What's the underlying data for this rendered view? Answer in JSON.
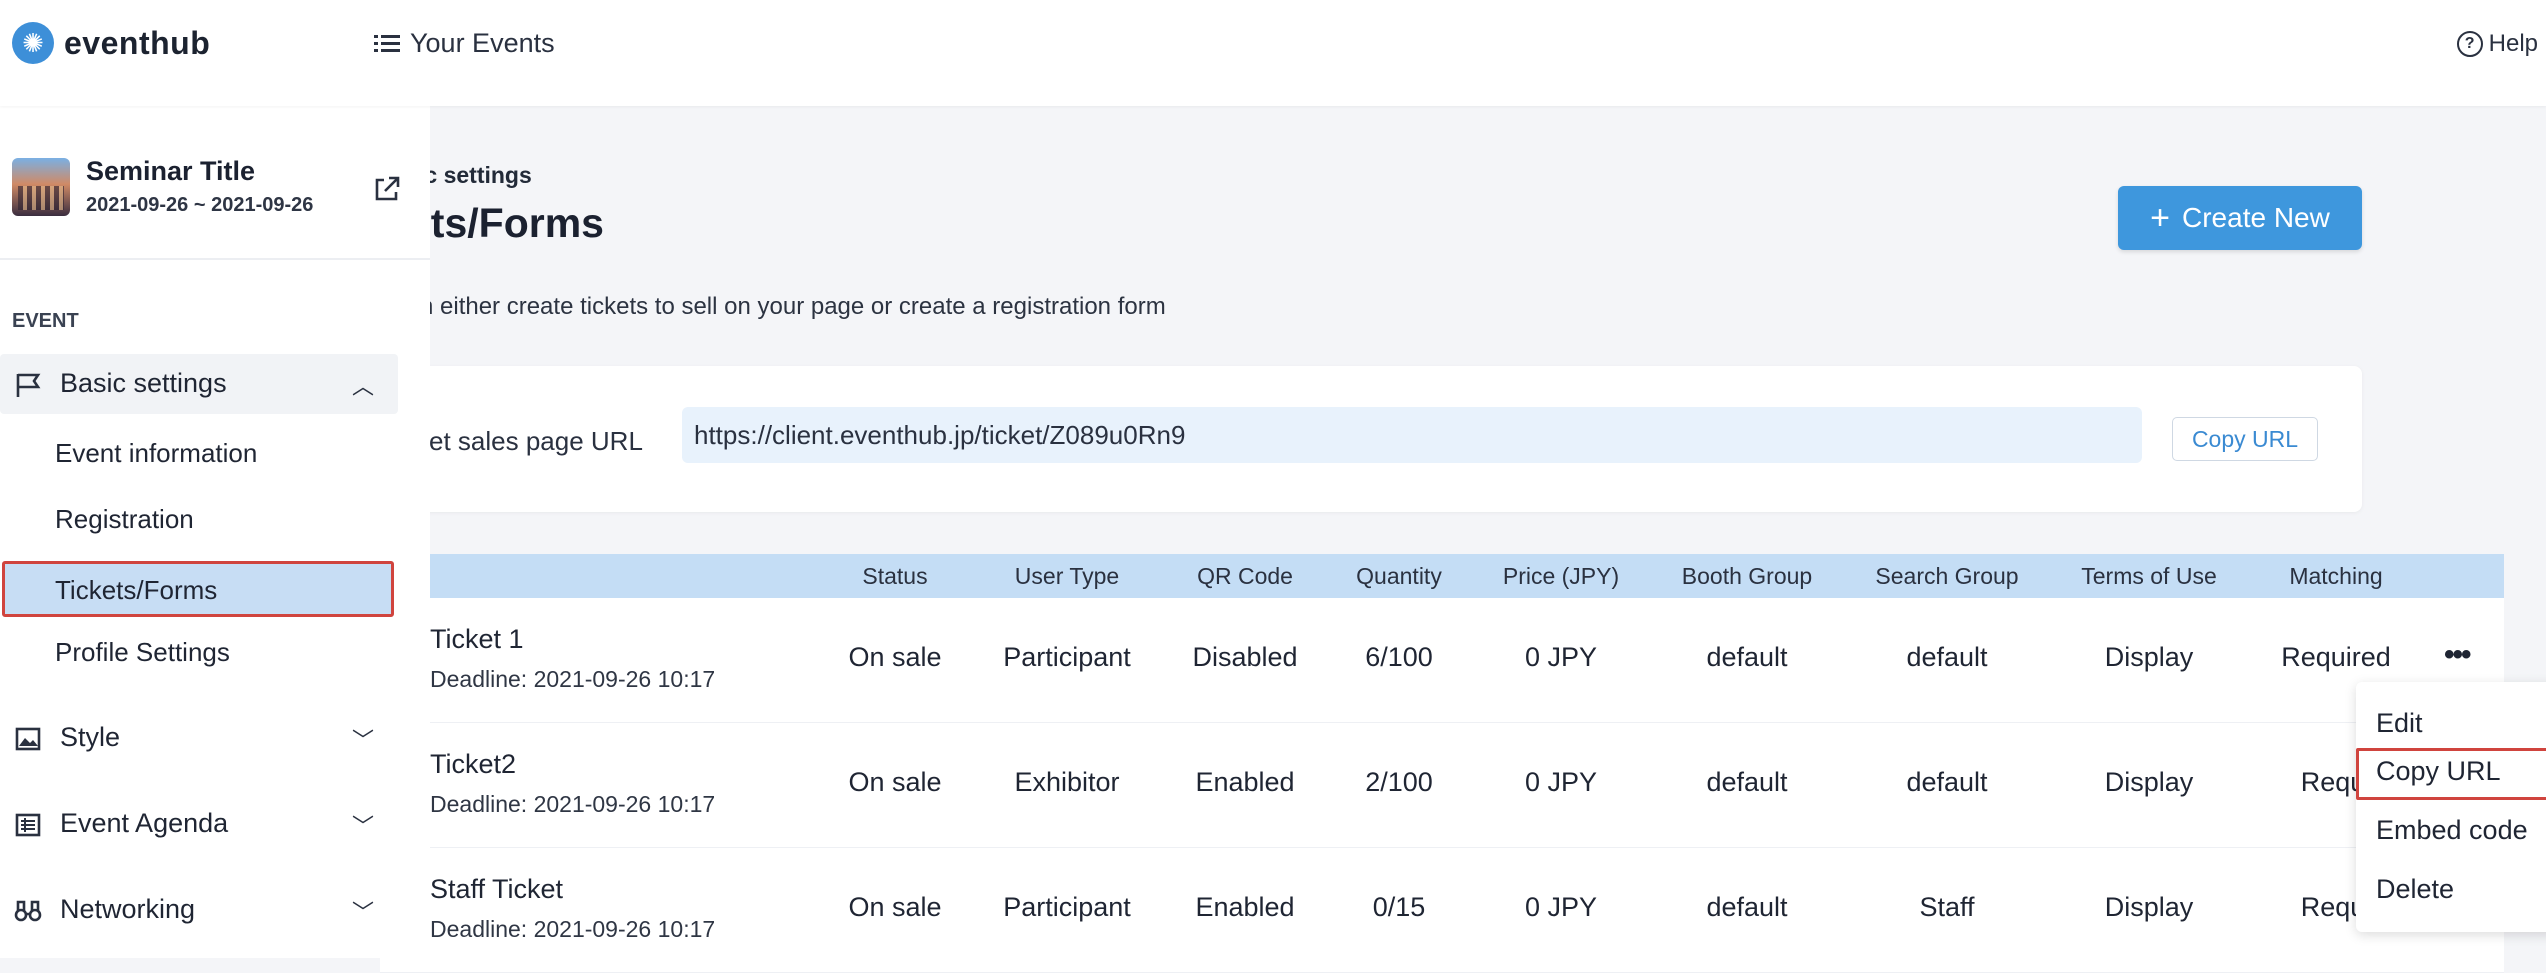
{
  "brand": {
    "name": "eventhub"
  },
  "topbar": {
    "your_events": "Your Events",
    "help": "Help"
  },
  "event": {
    "title": "Seminar Title",
    "dates": "2021-09-26 ~ 2021-09-26"
  },
  "sidebar": {
    "section_label": "EVENT",
    "groups": [
      {
        "label": "Basic settings",
        "icon": "flag-icon",
        "expanded": true
      },
      {
        "label": "Style",
        "icon": "image-icon"
      },
      {
        "label": "Event Agenda",
        "icon": "agenda-icon"
      },
      {
        "label": "Networking",
        "icon": "binoculars-icon"
      }
    ],
    "sub_items": [
      "Event information",
      "Registration",
      "Tickets/Forms",
      "Profile Settings"
    ],
    "active_sub": "Tickets/Forms"
  },
  "page": {
    "breadcrumb": "ic settings",
    "title": "ets/Forms",
    "description": "n either create tickets to sell on your page or create a registration form",
    "create_button": "Create New"
  },
  "url_card": {
    "label": "ket sales page URL",
    "url": "https://client.eventhub.jp/ticket/Z089u0Rn9",
    "copy_button": "Copy URL"
  },
  "table": {
    "columns": [
      "Status",
      "User Type",
      "QR Code",
      "Quantity",
      "Price (JPY)",
      "Booth Group",
      "Search Group",
      "Terms of Use",
      "Matching"
    ],
    "rows": [
      {
        "name": "Ticket 1",
        "deadline": "Deadline: 2021-09-26 10:17",
        "status": "On sale",
        "user_type": "Participant",
        "qr": "Disabled",
        "quantity": "6/100",
        "price": "0 JPY",
        "booth": "default",
        "search": "default",
        "terms": "Display",
        "matching": "Required"
      },
      {
        "name": "Ticket2",
        "deadline": "Deadline: 2021-09-26 10:17",
        "status": "On sale",
        "user_type": "Exhibitor",
        "qr": "Enabled",
        "quantity": "2/100",
        "price": "0 JPY",
        "booth": "default",
        "search": "default",
        "terms": "Display",
        "matching": "Requi"
      },
      {
        "name": "Staff Ticket",
        "deadline": "Deadline: 2021-09-26 10:17",
        "status": "On sale",
        "user_type": "Participant",
        "qr": "Enabled",
        "quantity": "0/15",
        "price": "0 JPY",
        "booth": "default",
        "search": "Staff",
        "terms": "Display",
        "matching": "Requi"
      }
    ],
    "row_menu": "•••"
  },
  "dropdown": {
    "items": [
      "Edit",
      "Copy URL",
      "Embed code",
      "Delete"
    ],
    "highlighted": "Copy URL"
  },
  "colors": {
    "accent": "#3e97dd",
    "highlight_border": "#d0443e",
    "table_header": "#c4ddf5",
    "active_item": "#c7ddf4"
  }
}
